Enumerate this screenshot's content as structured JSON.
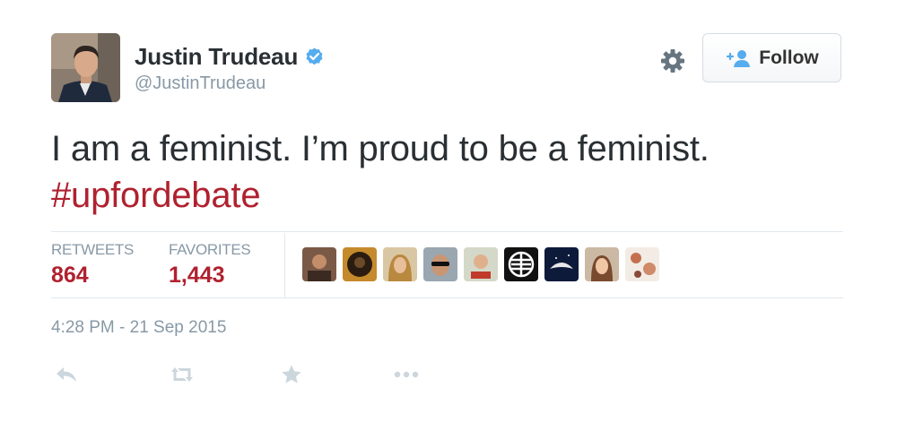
{
  "user": {
    "name": "Justin Trudeau",
    "handle": "@JustinTrudeau",
    "verified": true
  },
  "header": {
    "follow_label": "Follow",
    "icons": [
      "gear-icon",
      "follow-person-icon",
      "verified-badge-icon"
    ]
  },
  "tweet": {
    "text_line1": "I am a feminist. I’m proud to be a feminist.",
    "hashtag": "#upfordebate"
  },
  "stats": {
    "retweets_label": "RETWEETS",
    "retweets_value": "864",
    "favorites_label": "FAVORITES",
    "favorites_value": "1,443"
  },
  "favoriters": {
    "count_shown": 9
  },
  "timestamp": "4:28 PM - 21 Sep 2015",
  "actions": [
    "reply-icon",
    "retweet-icon",
    "favorite-star-icon",
    "more-icon"
  ],
  "colors": {
    "hashtag": "#b0212f",
    "stat_value": "#b0212f",
    "muted": "#8899a6",
    "verified": "#55acee",
    "action_icon": "#ccd6dd"
  }
}
